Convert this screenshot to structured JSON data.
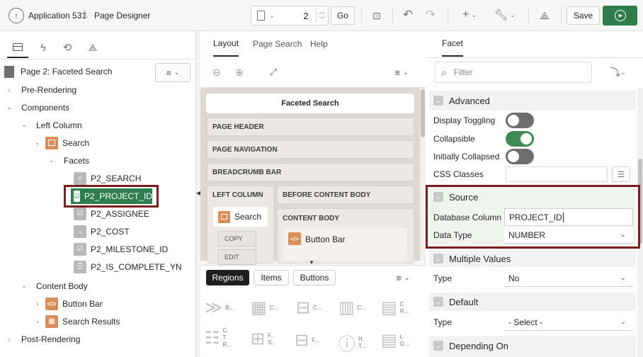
{
  "header": {
    "app_name": "Application 531",
    "page_designer": "Page Designer",
    "page_number": "2",
    "go_label": "Go",
    "save_label": "Save"
  },
  "left_panel": {
    "page_title": "Page 2: Faceted Search",
    "tree": {
      "pre_rendering": "Pre-Rendering",
      "components": "Components",
      "left_column": "Left Column",
      "search": "Search",
      "facets": "Facets",
      "p2_search": "P2_SEARCH",
      "p2_project_id": "P2_PROJECT_ID",
      "p2_assignee": "P2_ASSIGNEE",
      "p2_cost": "P2_COST",
      "p2_milestone_id": "P2_MILESTONE_ID",
      "p2_is_complete_yn": "P2_IS_COMPLETE_YN",
      "content_body": "Content Body",
      "button_bar": "Button Bar",
      "search_results": "Search Results",
      "post_rendering": "Post-Rendering"
    }
  },
  "center_panel": {
    "tabs": {
      "layout": "Layout",
      "page_search": "Page Search",
      "help": "Help"
    },
    "page_name": "Faceted Search",
    "regions": {
      "page_header": "PAGE HEADER",
      "page_navigation": "PAGE NAVIGATION",
      "breadcrumb_bar": "BREADCRUMB BAR",
      "left_column": "LEFT COLUMN",
      "before_content_body": "BEFORE CONTENT BODY",
      "content_body": "CONTENT BODY"
    },
    "search_region": "Search",
    "copy_label": "COPY",
    "edit_label": "EDIT",
    "button_bar": "Button Bar",
    "gallery_tabs": {
      "regions": "Regions",
      "items": "Items",
      "buttons": "Buttons"
    },
    "gallery_row1": [
      "B...",
      "C...",
      "C...",
      "C...",
      "C\nR..."
    ],
    "gallery_row2": [
      "C.\nT\nR...",
      "F..\nS..",
      "F...",
      "H.\nT...",
      "L\nG..."
    ]
  },
  "right_panel": {
    "tab": "Facet",
    "filter_placeholder": "Filter",
    "advanced": {
      "title": "Advanced",
      "display_toggling": "Display Toggling",
      "collapsible": "Collapsible",
      "initially_collapsed": "Initially Collapsed",
      "css_classes": "CSS Classes"
    },
    "source": {
      "title": "Source",
      "database_column_label": "Database Column",
      "database_column_value": "PROJECT_ID",
      "data_type_label": "Data Type",
      "data_type_value": "NUMBER"
    },
    "multiple_values": {
      "title": "Multiple Values",
      "type_label": "Type",
      "type_value": "No"
    },
    "default": {
      "title": "Default",
      "type_label": "Type",
      "type_value": "- Select -"
    },
    "depending_on": {
      "title": "Depending On"
    }
  },
  "colors": {
    "highlight_border": "#7a1d1d",
    "selected_green": "#2e7d4f",
    "toggle_on": "#3f8b57",
    "toggle_off": "#6e6e6e",
    "save_green": "#2f7d4b"
  }
}
